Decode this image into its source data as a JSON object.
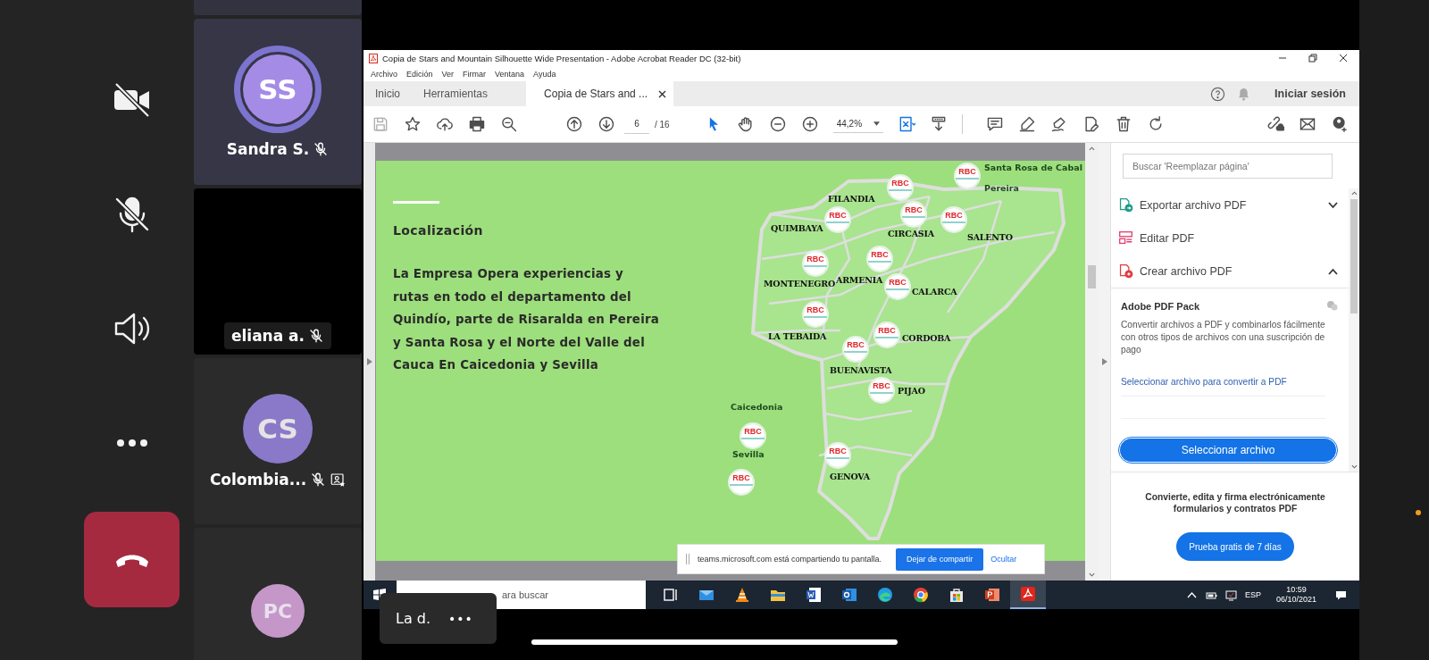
{
  "call_controls": [
    {
      "kind": "camera",
      "on": false
    },
    {
      "kind": "microphone",
      "on": false
    },
    {
      "kind": "speaker"
    },
    {
      "kind": "more"
    },
    {
      "kind": "hang_up"
    }
  ],
  "participants": [
    {
      "kind": "avatar",
      "name": "Sandra S.",
      "initials": "SS",
      "color": "#a48be6",
      "speaking": true,
      "muted": true
    },
    {
      "kind": "video",
      "name": "eliana a.",
      "muted": true
    },
    {
      "kind": "avatar",
      "name": "Colombia...",
      "initials": "CS",
      "color": "#8a79c9",
      "speaking": false,
      "muted": true,
      "presenting": true
    },
    {
      "kind": "avatar",
      "initials": "PC",
      "color": "#c497c8",
      "speaking": false
    }
  ],
  "acrobat": {
    "title": "Copia de Stars and Mountain Silhouette Wide Presentation - Adobe Acrobat Reader DC (32-bit)",
    "menu": [
      "Archivo",
      "Edición",
      "Ver",
      "Firmar",
      "Ventana",
      "Ayuda"
    ],
    "tabs": [
      {
        "label": "Inicio",
        "selected": false
      },
      {
        "label": "Herramientas",
        "selected": false
      },
      {
        "label": "Copia de Stars and ...",
        "selected": true
      }
    ],
    "sign_in": "Iniciar sesión",
    "toolbar": {
      "page": "6",
      "page_count": "/ 16",
      "zoom": "44,2%"
    },
    "slide": {
      "heading": "Localización",
      "body": "La Empresa Opera experiencias y rutas en todo el departamento del Quindío, parte de Risaralda en Pereira y Santa Rosa y el Norte del Valle del Cauca En Caicedonia y Sevilla",
      "places": [
        {
          "label": "Santa Rosa de Cabal",
          "kind": "outside"
        },
        {
          "label": "Pereira",
          "kind": "outside"
        },
        {
          "label": "FILANDIA",
          "kind": "inside"
        },
        {
          "label": "QUIMBAYA",
          "kind": "inside"
        },
        {
          "label": "CIRCASIA",
          "kind": "inside"
        },
        {
          "label": "SALENTO",
          "kind": "inside"
        },
        {
          "label": "MONTENEGRO",
          "kind": "inside"
        },
        {
          "label": "ARMENIA",
          "kind": "inside"
        },
        {
          "label": "CALARCA",
          "kind": "inside"
        },
        {
          "label": "LA TEBAIDA",
          "kind": "inside"
        },
        {
          "label": "CORDOBA",
          "kind": "inside"
        },
        {
          "label": "BUENAVISTA",
          "kind": "inside"
        },
        {
          "label": "PIJAO",
          "kind": "inside"
        },
        {
          "label": "Caicedonia",
          "kind": "outside"
        },
        {
          "label": "GENOVA",
          "kind": "inside"
        },
        {
          "label": "Sevilla",
          "kind": "outside"
        }
      ],
      "markers": [
        "RBC",
        "RBC",
        "RBC",
        "RBC",
        "RBC",
        "RBC",
        "RBC",
        "RBC",
        "RBC",
        "RBC",
        "RBC",
        "RBC",
        "RBC",
        "RBC",
        "RBC"
      ]
    },
    "tools_pane": {
      "search_placeholder": "Buscar 'Reemplazar página'",
      "tools": [
        {
          "kind": "export",
          "label": "Exportar archivo PDF",
          "expanded": false
        },
        {
          "kind": "edit",
          "label": "Editar PDF"
        },
        {
          "kind": "create",
          "label": "Crear archivo PDF",
          "expanded": true
        }
      ],
      "pack_title": "Adobe PDF Pack",
      "pack_text": "Convertir archivos a PDF y combinarlos fácilmente con otros tipos de archivos con una suscripción de pago",
      "pack_link": "Seleccionar archivo para convertir a PDF",
      "pack_button": "Seleccionar archivo",
      "promo_text": "Convierte, edita y firma electrónicamente formularios y contratos PDF",
      "promo_button": "Prueba gratis de 7 días"
    }
  },
  "sharing_bar": {
    "message": "teams.microsoft.com está compartiendo tu pantalla.",
    "stop": "Dejar de compartir",
    "hide": "Ocultar"
  },
  "taskbar": {
    "search": "ara buscar",
    "apps": [
      {
        "kind": "task_view",
        "active": false
      },
      {
        "kind": "mail",
        "active": false
      },
      {
        "kind": "vlc",
        "active": false
      },
      {
        "kind": "explorer",
        "active": false
      },
      {
        "kind": "word",
        "active": false
      },
      {
        "kind": "outlook",
        "active": false
      },
      {
        "kind": "edge",
        "active": false
      },
      {
        "kind": "chrome",
        "active": false
      },
      {
        "kind": "store",
        "active": false
      },
      {
        "kind": "powerpoint",
        "active": false
      },
      {
        "kind": "acrobat",
        "active": true
      }
    ],
    "language": "ESP",
    "time": "10:59",
    "date": "06/10/2021"
  },
  "presenter": {
    "name": "La d.",
    "more": "•••"
  }
}
